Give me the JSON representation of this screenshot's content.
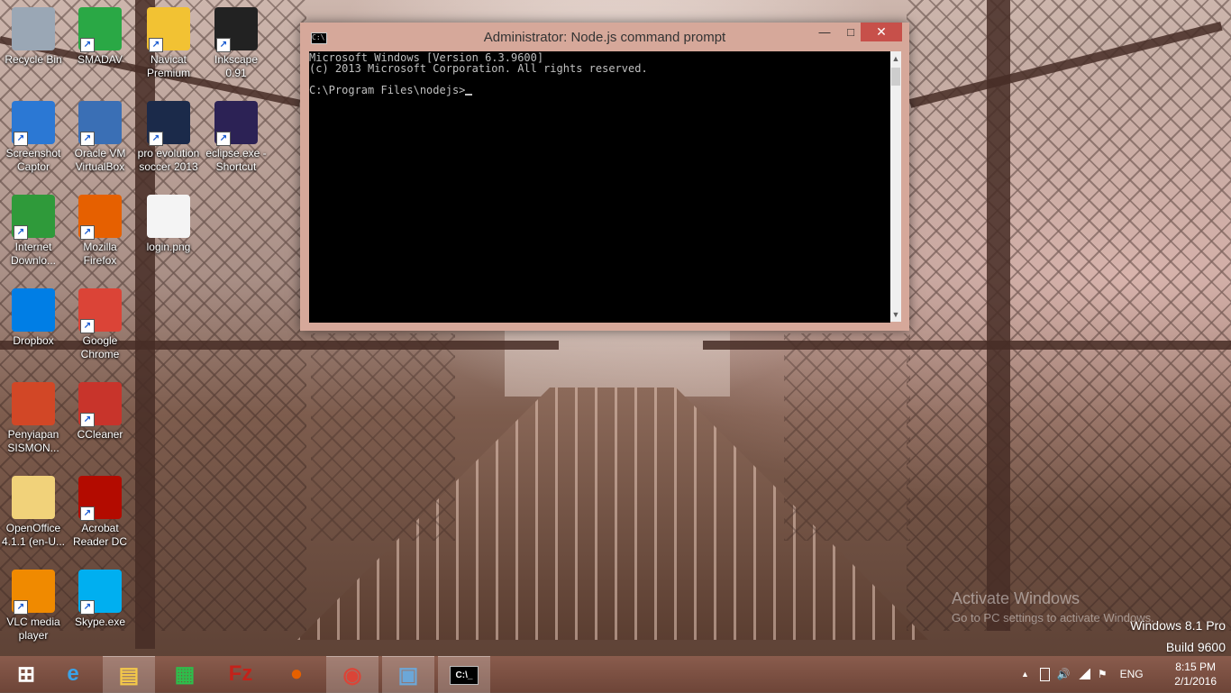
{
  "desktop": {
    "icons": [
      {
        "label": "Recycle Bin",
        "icon": "recycle-bin-icon",
        "color": "#9aa7b5"
      },
      {
        "label": "SMADAV",
        "icon": "smadav-icon",
        "color": "#2aa845"
      },
      {
        "label": "Navicat Premium",
        "icon": "navicat-icon",
        "color": "#f2c233"
      },
      {
        "label": "Inkscape 0.91",
        "icon": "inkscape-icon",
        "color": "#222222"
      },
      {
        "label": "Screenshot Captor",
        "icon": "screenshot-captor-icon",
        "color": "#2b78d4"
      },
      {
        "label": "Oracle VM VirtualBox",
        "icon": "virtualbox-icon",
        "color": "#3a6fb5"
      },
      {
        "label": "pro evolution soccer 2013",
        "icon": "pes-icon",
        "color": "#1b2a4a"
      },
      {
        "label": "eclipse.exe - Shortcut",
        "icon": "eclipse-icon",
        "color": "#2c2255"
      },
      {
        "label": "Internet Downlo...",
        "icon": "idm-icon",
        "color": "#2f9a3a"
      },
      {
        "label": "Mozilla Firefox",
        "icon": "firefox-icon",
        "color": "#e66000"
      },
      {
        "label": "login.png",
        "icon": "image-file-icon",
        "color": "#f4f4f4"
      },
      {
        "label": "Dropbox",
        "icon": "dropbox-icon",
        "color": "#007ee5"
      },
      {
        "label": "Google Chrome",
        "icon": "chrome-icon",
        "color": "#db4437"
      },
      {
        "label": "Penyiapan SISMON...",
        "icon": "powerpoint-file-icon",
        "color": "#d24726"
      },
      {
        "label": "CCleaner",
        "icon": "ccleaner-icon",
        "color": "#c8342b"
      },
      {
        "label": "OpenOffice 4.1.1 (en-U...",
        "icon": "folder-icon",
        "color": "#f1d27a"
      },
      {
        "label": "Acrobat Reader DC",
        "icon": "acrobat-icon",
        "color": "#b30b00"
      },
      {
        "label": "VLC media player",
        "icon": "vlc-icon",
        "color": "#f08a00"
      },
      {
        "label": "Skype.exe",
        "icon": "skype-icon",
        "color": "#00aff0"
      }
    ]
  },
  "cmd": {
    "title": "Administrator: Node.js command prompt",
    "icon_text": "C:\\.",
    "min": "—",
    "max": "□",
    "close": "✕",
    "lines": [
      "Microsoft Windows [Version 6.3.9600]",
      "(c) 2013 Microsoft Corporation. All rights reserved.",
      "",
      "C:\\Program Files\\nodejs>"
    ],
    "scroll_up": "▲",
    "scroll_down": "▼"
  },
  "watermark": {
    "activate": "Activate Windows",
    "goto": "Go to PC settings to activate Windows.",
    "edition": "Windows 8.1 Pro",
    "build": "Build 9600"
  },
  "taskbar": {
    "apps": [
      {
        "name": "start-button",
        "icon": "windows-logo-icon"
      },
      {
        "name": "internet-explorer",
        "icon": "ie-icon"
      },
      {
        "name": "file-explorer",
        "icon": "file-explorer-icon"
      },
      {
        "name": "store",
        "icon": "store-icon"
      },
      {
        "name": "filezilla",
        "icon": "filezilla-icon"
      },
      {
        "name": "firefox",
        "icon": "firefox-icon"
      },
      {
        "name": "chrome",
        "icon": "chrome-icon"
      },
      {
        "name": "remote-desktop",
        "icon": "remote-desktop-icon"
      },
      {
        "name": "cmd",
        "icon": "cmd-icon"
      }
    ],
    "tray": {
      "chevron": "▲",
      "language": "ENG",
      "time": "8:15 PM",
      "date": "2/1/2016"
    }
  }
}
